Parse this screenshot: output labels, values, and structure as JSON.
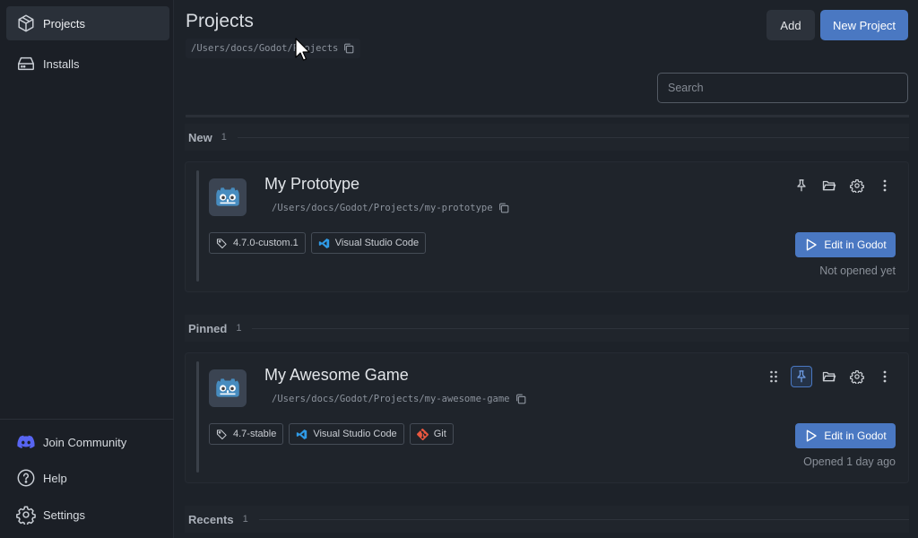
{
  "sidebar": {
    "top": [
      {
        "label": "Projects",
        "icon": "cube-icon",
        "active": true
      },
      {
        "label": "Installs",
        "icon": "drive-icon",
        "active": false
      }
    ],
    "bottom": [
      {
        "label": "Join Community",
        "icon": "discord-icon"
      },
      {
        "label": "Help",
        "icon": "help-icon"
      },
      {
        "label": "Settings",
        "icon": "gear-icon"
      }
    ]
  },
  "header": {
    "title": "Projects",
    "path": "/Users/docs/Godot/Projects",
    "add_label": "Add",
    "new_label": "New Project",
    "search_placeholder": "Search"
  },
  "sections": [
    {
      "name": "New",
      "count": "1"
    },
    {
      "name": "Pinned",
      "count": "1"
    },
    {
      "name": "Recents",
      "count": "1"
    }
  ],
  "projects": [
    {
      "title": "My Prototype",
      "path": "/Users/docs/Godot/Projects/my-prototype",
      "tags": [
        "4.7.0-custom.1",
        "Visual Studio Code"
      ],
      "edit_label": "Edit in Godot",
      "opened": "Not opened yet",
      "pinned": false
    },
    {
      "title": "My Awesome Game",
      "path": "/Users/docs/Godot/Projects/my-awesome-game",
      "tags": [
        "4.7-stable",
        "Visual Studio Code",
        "Git"
      ],
      "edit_label": "Edit in Godot",
      "opened": "Opened 1 day ago",
      "pinned": true
    }
  ],
  "colors": {
    "accent": "#4a78c2",
    "background": "#1d2229",
    "sidebar": "#1b1f26"
  }
}
